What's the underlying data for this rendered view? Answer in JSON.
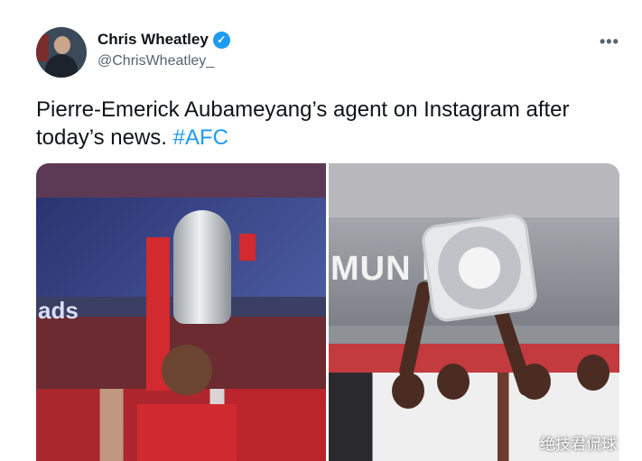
{
  "tweet": {
    "author_name": "Chris Wheatley",
    "verified_mark": "✓",
    "handle": "@ChrisWheatley_",
    "more_label": "•••",
    "text_main": "Pierre-Emerick Aubameyang’s agent on Instagram after today’s news. ",
    "hashtag": "#AFC"
  },
  "photos": {
    "left_banner_text": "ads",
    "right_banner_text": "MUN   HIEI"
  },
  "watermark": "绝技君侃球",
  "colors": {
    "accent": "#1d9bf0",
    "text": "#0f1419",
    "secondary": "#536471"
  },
  "icons": {
    "verified": "verified-badge-icon",
    "more": "more-options-icon"
  }
}
